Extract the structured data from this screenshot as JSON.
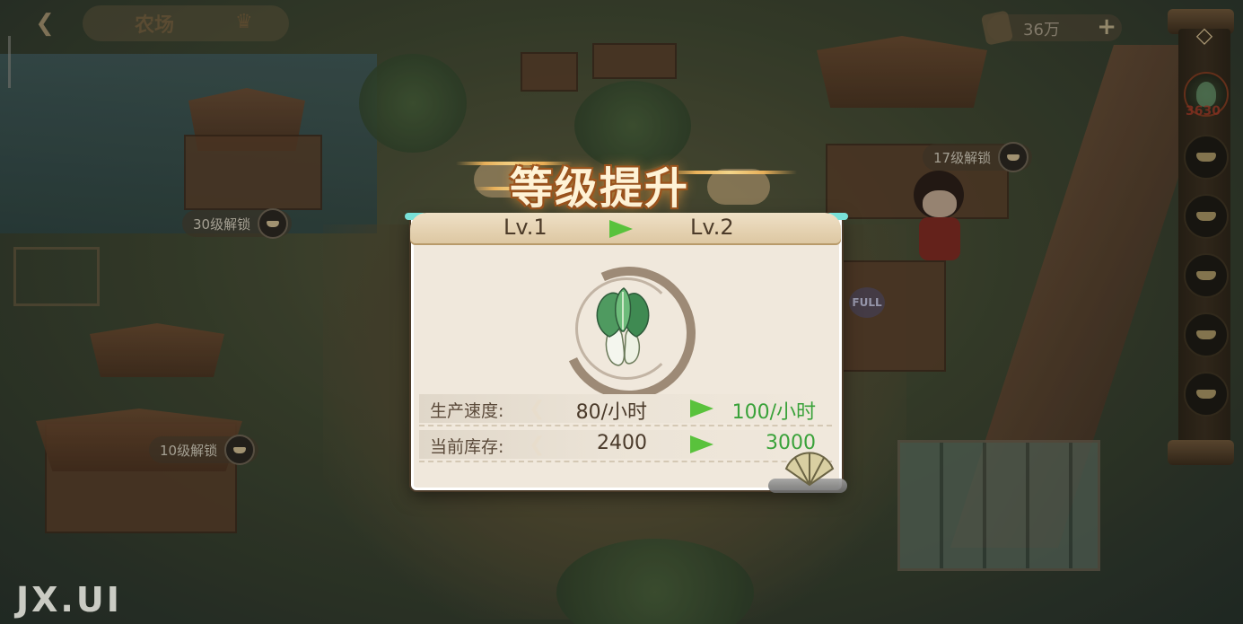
{
  "header": {
    "title": "农场"
  },
  "currency": {
    "value": "36万",
    "plus_label": "+"
  },
  "unlock_badges": [
    "30级解锁",
    "17级解锁",
    "10级解锁"
  ],
  "right_panel": {
    "crop_count": "3630"
  },
  "full_badge": "FULL",
  "popup": {
    "banner_title": "等级提升",
    "level_from": "Lv.1",
    "level_to": "Lv.2",
    "stats": [
      {
        "label": "生产速度:",
        "old": "80/小时",
        "new": "100/小时"
      },
      {
        "label": "当前库存:",
        "old": "2400",
        "new": "3000"
      }
    ]
  },
  "watermark": "JX.UI",
  "colors": {
    "upgrade_green": "#3aa23a",
    "arrow_green": "#59c23c",
    "panel_bg": "#f0e8dc",
    "banner_gold": "#e8b05a"
  },
  "icons": [
    "back-arrow-icon",
    "crown-icon",
    "coin-icon",
    "plus-icon",
    "panel-toggle-icon",
    "lock-icon",
    "bokchoy-icon",
    "arrow-right-icon",
    "fan-icon"
  ]
}
